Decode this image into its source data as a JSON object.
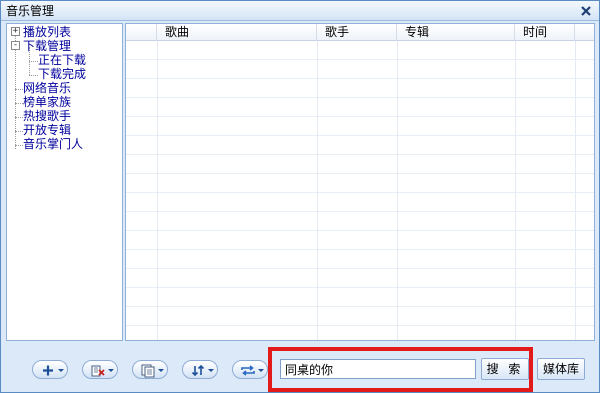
{
  "window": {
    "title": "音乐管理"
  },
  "tree": {
    "items": [
      {
        "label": "播放列表",
        "expander": "+"
      },
      {
        "label": "下载管理",
        "expander": "-"
      },
      {
        "label": "正在下载"
      },
      {
        "label": "下载完成"
      },
      {
        "label": "网络音乐"
      },
      {
        "label": "榜单家族"
      },
      {
        "label": "热搜歌手"
      },
      {
        "label": "开放专辑"
      },
      {
        "label": "音乐掌门人"
      }
    ]
  },
  "list": {
    "columns": [
      "歌曲",
      "歌手",
      "专辑",
      "时间"
    ],
    "rows": []
  },
  "toolbar": {
    "buttons": [
      {
        "icon": "add-icon"
      },
      {
        "icon": "delete-icon"
      },
      {
        "icon": "copy-icon"
      },
      {
        "icon": "sort-icon"
      },
      {
        "icon": "repeat-icon"
      }
    ]
  },
  "search": {
    "value": "同桌的你",
    "button_label": "搜 索"
  },
  "library_button_label": "媒体库",
  "colors": {
    "highlight": "#e21a1a",
    "tree_text": "#00009c",
    "window_bg": "#dbe9f8"
  }
}
